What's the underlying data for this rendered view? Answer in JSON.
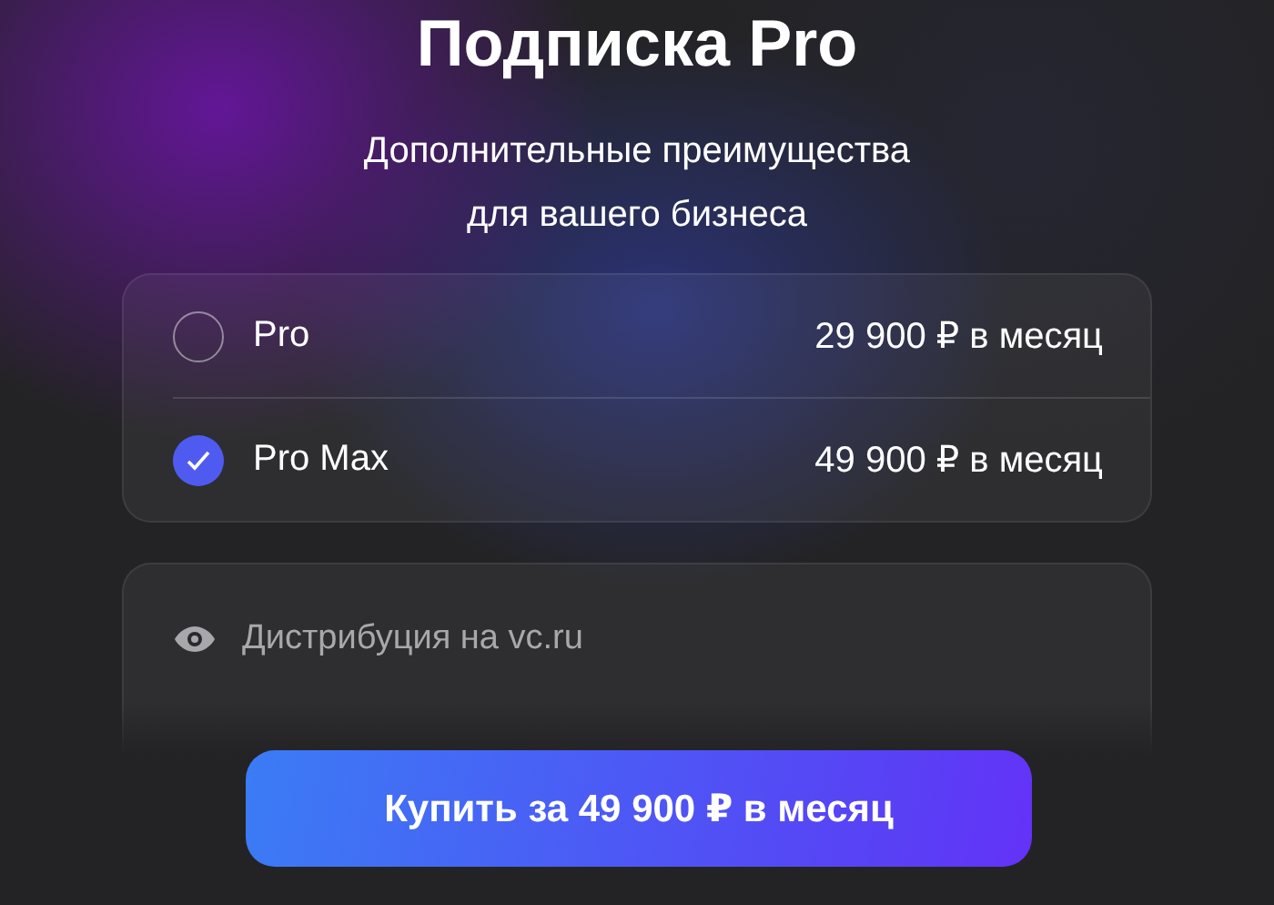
{
  "title": "Подписка Pro",
  "subtitle": [
    "Дополнительные преимущества",
    "для вашего бизнеса"
  ],
  "plans": [
    {
      "name": "Pro",
      "price": "29 900 ₽ в месяц",
      "selected": false
    },
    {
      "name": "Pro Max",
      "price": "49 900 ₽ в месяц",
      "selected": true
    }
  ],
  "features": [
    {
      "label": "Дистрибуция на vc.ru"
    }
  ],
  "buy_button": "Купить за 49 900 ₽ в месяц"
}
